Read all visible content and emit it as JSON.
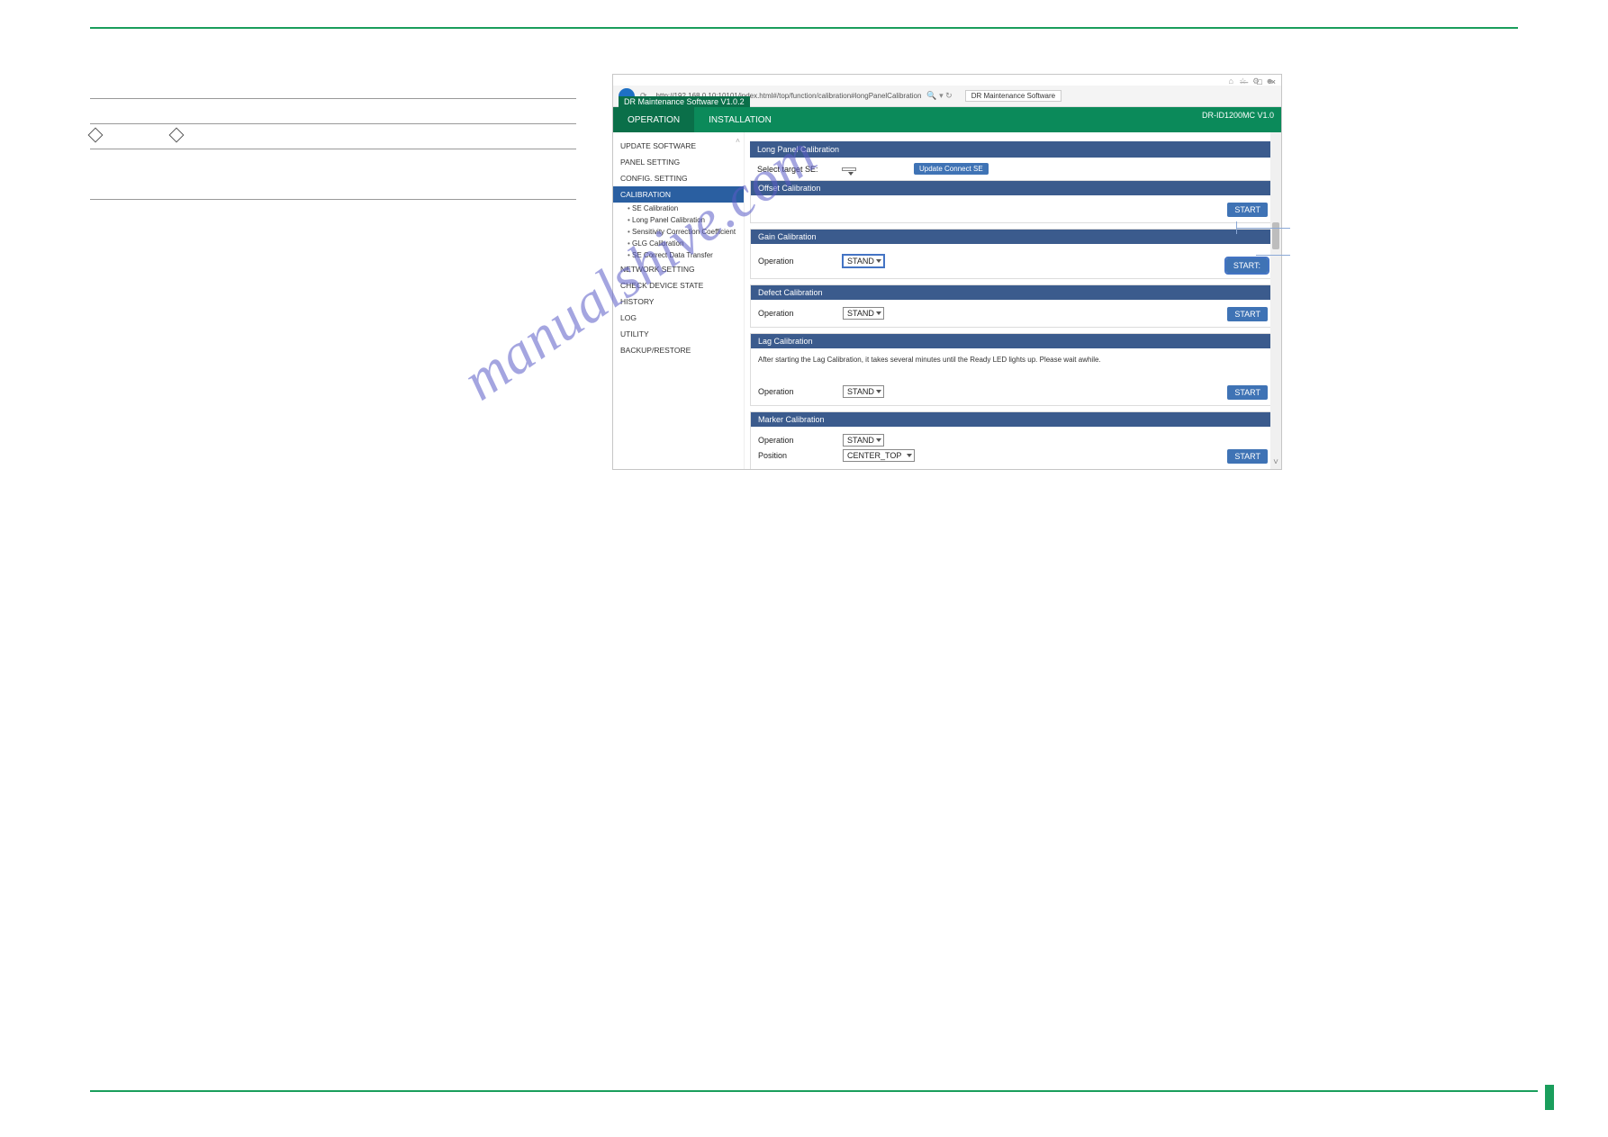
{
  "leftTable": {
    "r1": {
      "a": "",
      "b": "",
      "c": ""
    },
    "r2": {
      "a": "",
      "b": "",
      "c": ""
    },
    "r3_diamond": true,
    "r4": {
      "a": "",
      "b": "",
      "c": ""
    },
    "r5": {
      "a": "",
      "b": "",
      "c": ""
    }
  },
  "watermark": "manualshive.com",
  "shot": {
    "window_controls": {
      "min": "—",
      "max": "□",
      "close": "×"
    },
    "favicons": "⌂ ☆ ⚙ ☻",
    "back": "←",
    "url": "http://192.168.0.10:10101/index.html#/top/function/calibration#longPanelCalibration",
    "searchglyph": "🔍 ▾ ↻",
    "browser_tab": "DR Maintenance Software",
    "app_title": "DR Maintenance Software V1.0.2",
    "right_version": "DR-ID1200MC V1.0",
    "tabs": {
      "operation": "OPERATION",
      "installation": "INSTALLATION"
    },
    "sidebar": {
      "scroll_hint": "˄",
      "items": {
        "update": "UPDATE SOFTWARE",
        "panel": "PANEL SETTING",
        "config": "CONFIG. SETTING",
        "calibration": "CALIBRATION",
        "sub": {
          "se": "SE Calibration",
          "lp": "Long Panel Calibration",
          "scc": "Sensitivity Correction Coefficient",
          "glg": "GLG Calibration",
          "secdt": "SE Correct Data Transfer"
        },
        "network": "NETWORK SETTING",
        "check": "CHECK DEVICE STATE",
        "history": "HISTORY",
        "log": "LOG",
        "utility": "UTILITY",
        "backup": "BACKUP/RESTORE"
      }
    },
    "main": {
      "title": "Long Panel Calibration",
      "targetrow": {
        "label": "Select target SE:",
        "sel": "",
        "update_btn": "Update Connect SE"
      },
      "offset": {
        "head": "Offset Calibration",
        "start": "START"
      },
      "gain": {
        "head": "Gain Calibration",
        "op_label": "Operation",
        "sel": "STAND",
        "start": "START:"
      },
      "defect": {
        "head": "Defect Calibration",
        "op_label": "Operation",
        "sel": "STAND",
        "start": "START"
      },
      "lag": {
        "head": "Lag Calibration",
        "note": "After starting the Lag Calibration, it takes several minutes until the Ready LED lights up. Please wait awhile.",
        "op_label": "Operation",
        "sel": "STAND",
        "start": "START"
      },
      "marker": {
        "head": "Marker Calibration",
        "op_label": "Operation",
        "sel": "STAND",
        "pos_label": "Position",
        "pos_sel": "CENTER_TOP",
        "start": "START"
      },
      "scroll_down": "˅"
    }
  }
}
